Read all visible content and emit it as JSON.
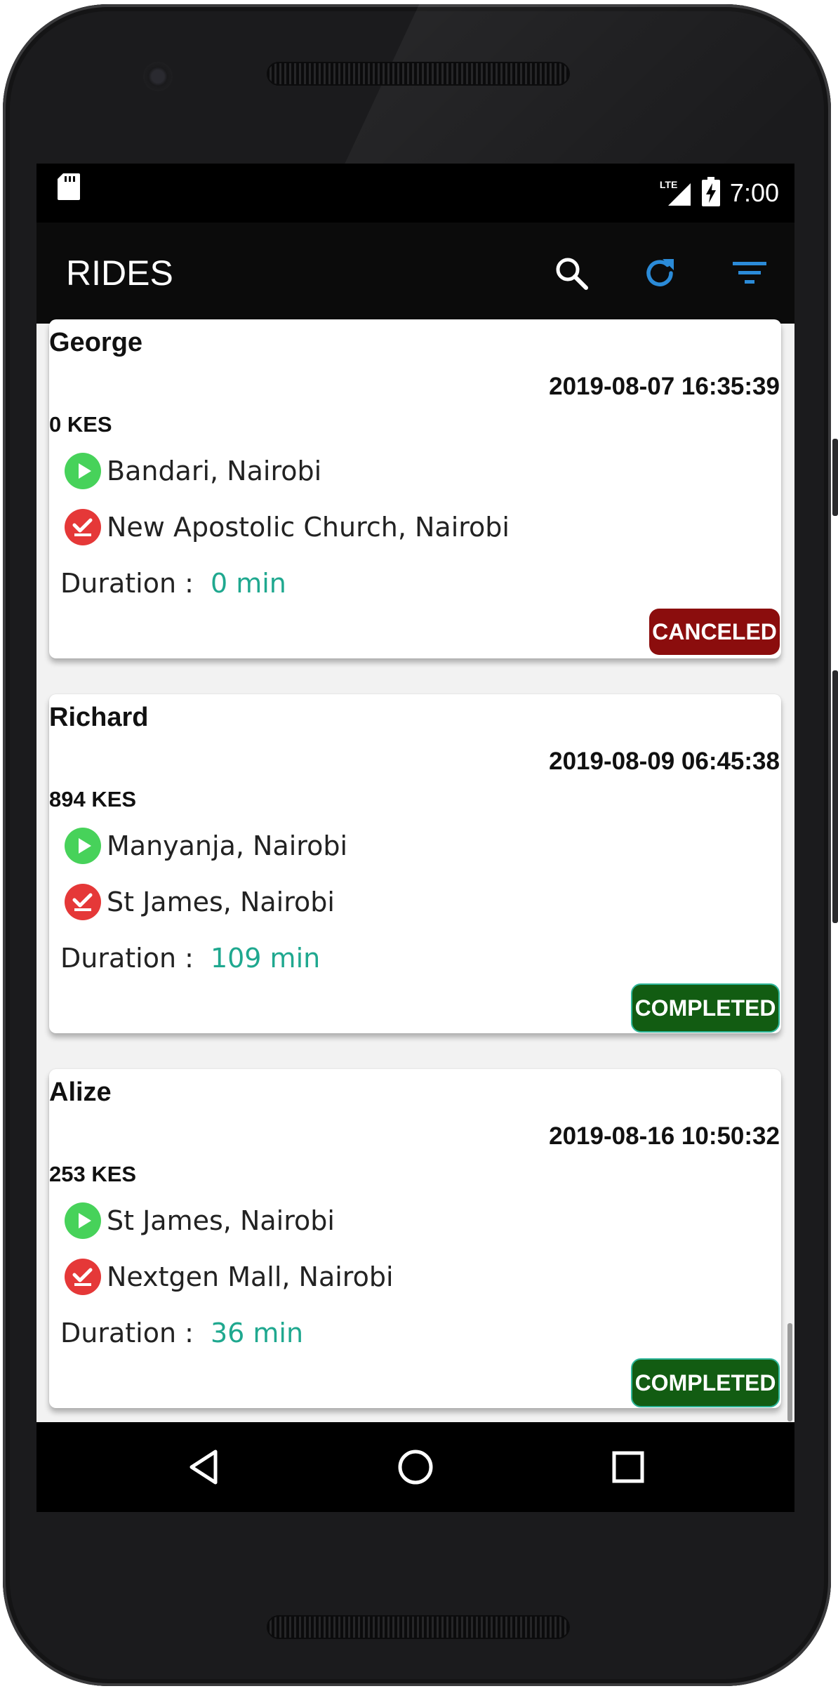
{
  "status_bar": {
    "network": "LTE",
    "time": "7:00",
    "icons": [
      "sd-card-icon",
      "lte-signal-icon",
      "battery-charging-icon"
    ]
  },
  "app_bar": {
    "title": "RIDES",
    "actions": [
      {
        "name": "search",
        "icon": "search-icon",
        "color": "#ffffff"
      },
      {
        "name": "refresh",
        "icon": "refresh-icon",
        "color": "#2b8bd8"
      },
      {
        "name": "filter",
        "icon": "filter-icon",
        "color": "#2b8bd8"
      }
    ]
  },
  "rides": [
    {
      "name": "George",
      "date": "2019-08-07 16:35:39",
      "fare": "0 KES",
      "pickup": "Bandari, Nairobi",
      "dropoff": "New Apostolic Church, Nairobi",
      "duration_label": "Duration :",
      "duration_value": "0 min",
      "status": "CANCELED",
      "status_color": "#8b0d0d"
    },
    {
      "name": "Richard",
      "date": "2019-08-09 06:45:38",
      "fare": "894 KES",
      "pickup": "Manyanja, Nairobi",
      "dropoff": "St James, Nairobi",
      "duration_label": "Duration :",
      "duration_value": "109 min",
      "status": "COMPLETED",
      "status_color": "#125c12"
    },
    {
      "name": "Alize",
      "date": "2019-08-16 10:50:32",
      "fare": "253 KES",
      "pickup": "St James, Nairobi",
      "dropoff": "Nextgen Mall, Nairobi",
      "duration_label": "Duration :",
      "duration_value": "36 min",
      "status": "COMPLETED",
      "status_color": "#125c12"
    }
  ],
  "colors": {
    "pickup_icon": "#47d25a",
    "dropoff_icon": "#e53838",
    "duration_value": "#1fa88f",
    "completed_border": "#2fb69a"
  },
  "nav_bar": {
    "buttons": [
      "back-icon",
      "home-icon",
      "recents-icon"
    ]
  }
}
